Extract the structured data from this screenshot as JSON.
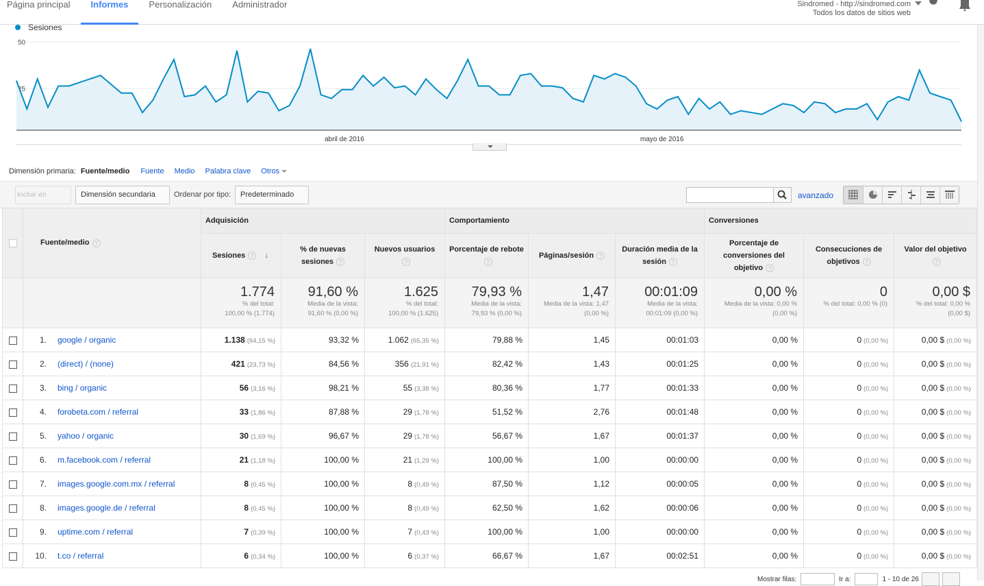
{
  "nav": {
    "tabs": [
      "Página principal",
      "Informes",
      "Personalización",
      "Administrador"
    ],
    "active": "Informes"
  },
  "account": {
    "line1": "Sindromed - http://sindromed.com",
    "line2": "Todos los datos de sitios web"
  },
  "chart": {
    "legend": "Sesiones",
    "y_ticks": [
      "50",
      "25"
    ],
    "x_labels": [
      "abril de 2016",
      "mayo de 2016"
    ]
  },
  "chart_data": {
    "type": "area",
    "series": [
      {
        "name": "Sesiones",
        "color": "#058dc7",
        "values": [
          28,
          12,
          29,
          13,
          25,
          25,
          27,
          29,
          31,
          26,
          21,
          21,
          10,
          17,
          29,
          40,
          19,
          20,
          25,
          16,
          20,
          45,
          16,
          22,
          21,
          11,
          14,
          25,
          46,
          20,
          18,
          23,
          23,
          31,
          25,
          30,
          24,
          25,
          20,
          29,
          23,
          18,
          28,
          40,
          25,
          25,
          20,
          20,
          31,
          32,
          25,
          25,
          24,
          18,
          16,
          31,
          29,
          32,
          30,
          25,
          15,
          12,
          17,
          19,
          9,
          18,
          12,
          16,
          9,
          11,
          10,
          9,
          12,
          15,
          14,
          10,
          16,
          15,
          10,
          12,
          12,
          15,
          6,
          16,
          19,
          17,
          34,
          21,
          19,
          17,
          5
        ]
      }
    ],
    "ylim": [
      0,
      50
    ],
    "y_ticks": [
      25,
      50
    ],
    "x_labels": [
      "abril de 2016",
      "mayo de 2016"
    ],
    "grid": true
  },
  "dimension": {
    "label": "Dimensión primaria:",
    "current": "Fuente/medio",
    "links": [
      "Fuente",
      "Medio",
      "Palabra clave"
    ],
    "more": "Otros"
  },
  "toolbar": {
    "include": "Incluir en gráfico",
    "secondary": "Dimensión secundaria",
    "sort_label": "Ordenar por tipo:",
    "sort_value": "Predeterminado",
    "advanced": "avanzado"
  },
  "table": {
    "groups": [
      "Adquisición",
      "Comportamiento",
      "Conversiones"
    ],
    "dim_header": "Fuente/medio",
    "columns": [
      "Sesiones",
      "% de nuevas sesiones",
      "Nuevos usuarios",
      "Porcentaje de rebote",
      "Páginas/sesión",
      "Duración media de la sesión",
      "Porcentaje de conversiones del objetivo",
      "Consecuciones de objetivos",
      "Valor del objetivo"
    ],
    "totals": [
      {
        "big": "1.774",
        "sub1": "% del total:",
        "sub2": "100,00 % (1.774)"
      },
      {
        "big": "91,60 %",
        "sub1": "Media de la vista:",
        "sub2": "91,60 % (0,00 %)"
      },
      {
        "big": "1.625",
        "sub1": "% del total:",
        "sub2": "100,00 % (1.625)"
      },
      {
        "big": "79,93 %",
        "sub1": "Media de la vista:",
        "sub2": "79,93 % (0,00 %)"
      },
      {
        "big": "1,47",
        "sub1": "Media de la vista: 1,47",
        "sub2": "(0,00 %)"
      },
      {
        "big": "00:01:09",
        "sub1": "Media de la vista:",
        "sub2": "00:01:09 (0,00 %)"
      },
      {
        "big": "0,00 %",
        "sub1": "Media de la vista: 0,00 %",
        "sub2": "(0,00 %)"
      },
      {
        "big": "0",
        "sub1": "% del total: 0,00 % (0)",
        "sub2": ""
      },
      {
        "big": "0,00 $",
        "sub1": "% del total: 0,00 %",
        "sub2": "(0,00 $)"
      }
    ],
    "rows": [
      {
        "n": "1.",
        "src": "google / organic",
        "ses": "1.138",
        "sesp": "(64,15 %)",
        "nuevas": "93,32 %",
        "nu": "1.062",
        "nup": "(65,35 %)",
        "reb": "79,88 %",
        "pag": "1,45",
        "dur": "00:01:03",
        "conv": "0,00 %",
        "obj": "0",
        "objp": "(0,00 %)",
        "val": "0,00 $",
        "valp": "(0,00 %)"
      },
      {
        "n": "2.",
        "src": "(direct) / (none)",
        "ses": "421",
        "sesp": "(23,73 %)",
        "nuevas": "84,56 %",
        "nu": "356",
        "nup": "(21,91 %)",
        "reb": "82,42 %",
        "pag": "1,43",
        "dur": "00:01:25",
        "conv": "0,00 %",
        "obj": "0",
        "objp": "(0,00 %)",
        "val": "0,00 $",
        "valp": "(0,00 %)"
      },
      {
        "n": "3.",
        "src": "bing / organic",
        "ses": "56",
        "sesp": "(3,16 %)",
        "nuevas": "98,21 %",
        "nu": "55",
        "nup": "(3,38 %)",
        "reb": "80,36 %",
        "pag": "1,77",
        "dur": "00:01:33",
        "conv": "0,00 %",
        "obj": "0",
        "objp": "(0,00 %)",
        "val": "0,00 $",
        "valp": "(0,00 %)"
      },
      {
        "n": "4.",
        "src": "forobeta.com / referral",
        "ses": "33",
        "sesp": "(1,86 %)",
        "nuevas": "87,88 %",
        "nu": "29",
        "nup": "(1,78 %)",
        "reb": "51,52 %",
        "pag": "2,76",
        "dur": "00:01:48",
        "conv": "0,00 %",
        "obj": "0",
        "objp": "(0,00 %)",
        "val": "0,00 $",
        "valp": "(0,00 %)"
      },
      {
        "n": "5.",
        "src": "yahoo / organic",
        "ses": "30",
        "sesp": "(1,69 %)",
        "nuevas": "96,67 %",
        "nu": "29",
        "nup": "(1,78 %)",
        "reb": "56,67 %",
        "pag": "1,67",
        "dur": "00:01:37",
        "conv": "0,00 %",
        "obj": "0",
        "objp": "(0,00 %)",
        "val": "0,00 $",
        "valp": "(0,00 %)"
      },
      {
        "n": "6.",
        "src": "m.facebook.com / referral",
        "ses": "21",
        "sesp": "(1,18 %)",
        "nuevas": "100,00 %",
        "nu": "21",
        "nup": "(1,29 %)",
        "reb": "100,00 %",
        "pag": "1,00",
        "dur": "00:00:00",
        "conv": "0,00 %",
        "obj": "0",
        "objp": "(0,00 %)",
        "val": "0,00 $",
        "valp": "(0,00 %)"
      },
      {
        "n": "7.",
        "src": "images.google.com.mx / referral",
        "ses": "8",
        "sesp": "(0,45 %)",
        "nuevas": "100,00 %",
        "nu": "8",
        "nup": "(0,49 %)",
        "reb": "87,50 %",
        "pag": "1,12",
        "dur": "00:00:05",
        "conv": "0,00 %",
        "obj": "0",
        "objp": "(0,00 %)",
        "val": "0,00 $",
        "valp": "(0,00 %)"
      },
      {
        "n": "8.",
        "src": "images.google.de / referral",
        "ses": "8",
        "sesp": "(0,45 %)",
        "nuevas": "100,00 %",
        "nu": "8",
        "nup": "(0,49 %)",
        "reb": "62,50 %",
        "pag": "1,62",
        "dur": "00:00:06",
        "conv": "0,00 %",
        "obj": "0",
        "objp": "(0,00 %)",
        "val": "0,00 $",
        "valp": "(0,00 %)"
      },
      {
        "n": "9.",
        "src": "uptime.com / referral",
        "ses": "7",
        "sesp": "(0,39 %)",
        "nuevas": "100,00 %",
        "nu": "7",
        "nup": "(0,43 %)",
        "reb": "100,00 %",
        "pag": "1,00",
        "dur": "00:00:00",
        "conv": "0,00 %",
        "obj": "0",
        "objp": "(0,00 %)",
        "val": "0,00 $",
        "valp": "(0,00 %)"
      },
      {
        "n": "10.",
        "src": "t.co / referral",
        "ses": "6",
        "sesp": "(0,34 %)",
        "nuevas": "100,00 %",
        "nu": "6",
        "nup": "(0,37 %)",
        "reb": "66,67 %",
        "pag": "1,67",
        "dur": "00:02:51",
        "conv": "0,00 %",
        "obj": "0",
        "objp": "(0,00 %)",
        "val": "0,00 $",
        "valp": "(0,00 %)"
      }
    ]
  },
  "pager": {
    "show_label": "Mostrar filas:",
    "goto_label": "Ir a:",
    "range": "1 - 10 de 26"
  }
}
